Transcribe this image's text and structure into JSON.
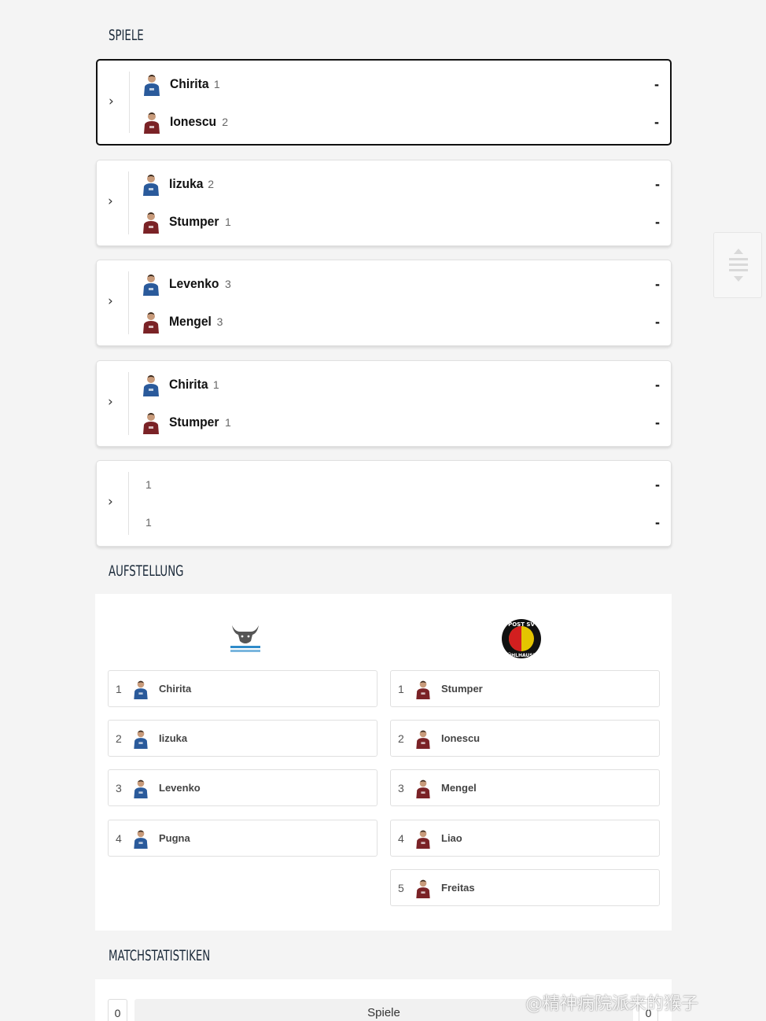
{
  "sections": {
    "games_title": "SPIELE",
    "lineup_title": "AUFSTELLUNG",
    "stats_title": "MATCHSTATISTIKEN"
  },
  "colors": {
    "home_jersey": "#2a5a9b",
    "away_jersey": "#7a2226",
    "active_border": "#111111"
  },
  "games": [
    {
      "active": true,
      "home": {
        "name": "Chirita",
        "number": "1"
      },
      "away": {
        "name": "Ionescu",
        "number": "2"
      },
      "home_score": "-",
      "away_score": "-"
    },
    {
      "active": false,
      "home": {
        "name": "Iizuka",
        "number": "2"
      },
      "away": {
        "name": "Stumper",
        "number": "1"
      },
      "home_score": "-",
      "away_score": "-"
    },
    {
      "active": false,
      "home": {
        "name": "Levenko",
        "number": "3"
      },
      "away": {
        "name": "Mengel",
        "number": "3"
      },
      "home_score": "-",
      "away_score": "-"
    },
    {
      "active": false,
      "home": {
        "name": "Chirita",
        "number": "1"
      },
      "away": {
        "name": "Stumper",
        "number": "1"
      },
      "home_score": "-",
      "away_score": "-"
    },
    {
      "active": false,
      "home": {
        "name": "",
        "number": "1"
      },
      "away": {
        "name": "",
        "number": "1"
      },
      "home_score": "-",
      "away_score": "-"
    }
  ],
  "lineup": {
    "home_logo_icon": "bull-logo-icon",
    "home_logo_text": "TTF OCHSENHAUSEN",
    "away_logo_icon": "post-sv-logo-icon",
    "away_logo_text": "POST SV MÜHLHAUSEN",
    "home": [
      {
        "number": "1",
        "name": "Chirita"
      },
      {
        "number": "2",
        "name": "Iizuka"
      },
      {
        "number": "3",
        "name": "Levenko"
      },
      {
        "number": "4",
        "name": "Pugna"
      }
    ],
    "away": [
      {
        "number": "1",
        "name": "Stumper"
      },
      {
        "number": "2",
        "name": "Ionescu"
      },
      {
        "number": "3",
        "name": "Mengel"
      },
      {
        "number": "4",
        "name": "Liao"
      },
      {
        "number": "5",
        "name": "Freitas"
      }
    ]
  },
  "stats": {
    "label": "Spiele",
    "home_value": "0",
    "away_value": "0"
  },
  "side_widget_icon": "scroll-handle-icon",
  "watermark": "@精神病院派来的猴子"
}
